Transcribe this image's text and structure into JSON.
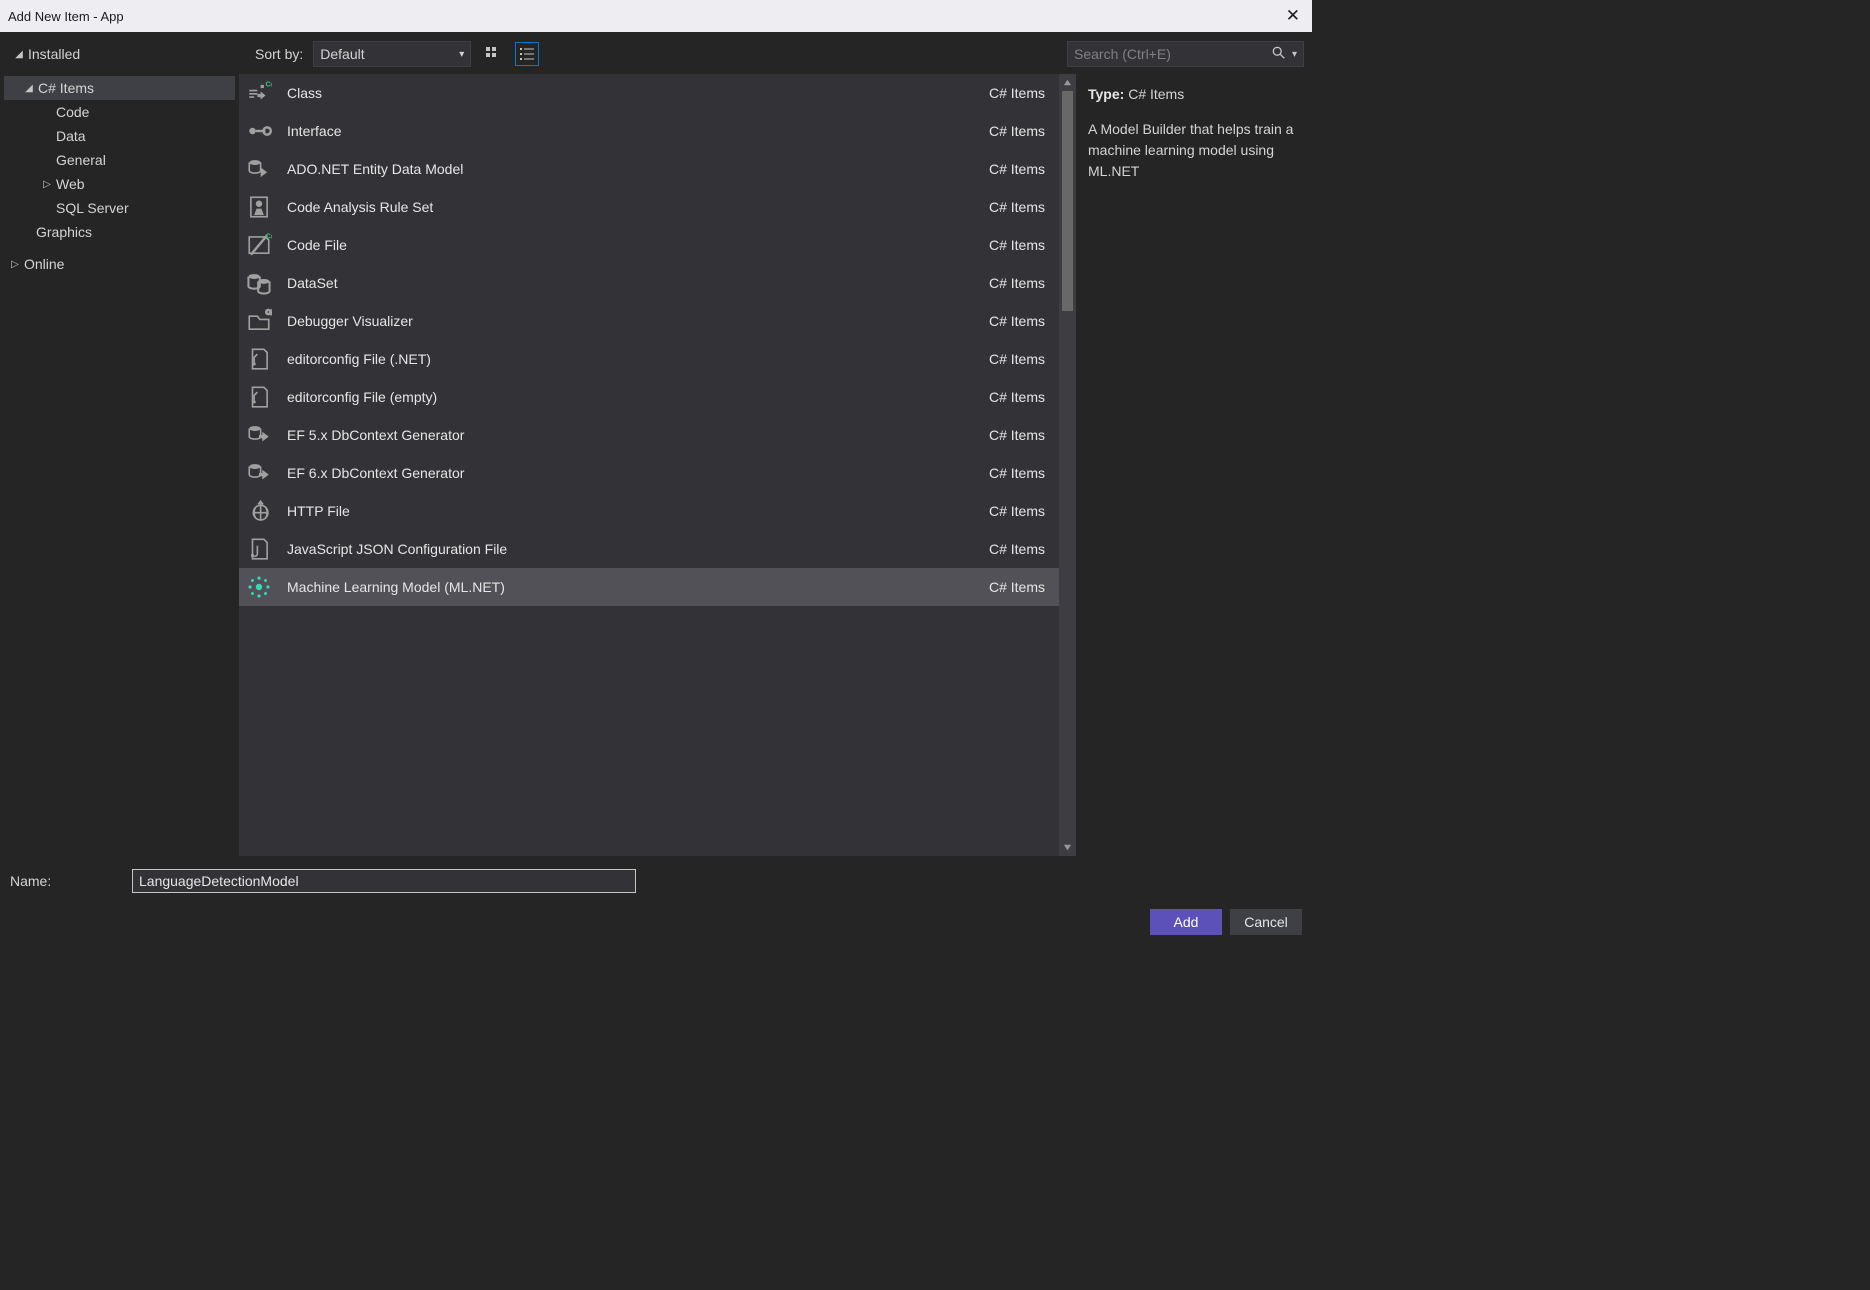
{
  "window": {
    "title": "Add New Item - App"
  },
  "sort": {
    "label": "Sort by:",
    "value": "Default"
  },
  "search": {
    "placeholder": "Search (Ctrl+E)"
  },
  "tree": {
    "installed": "Installed",
    "csitems": "C# Items",
    "nodes": {
      "code": "Code",
      "data": "Data",
      "general": "General",
      "web": "Web",
      "sqlserver": "SQL Server"
    },
    "graphics": "Graphics",
    "online": "Online"
  },
  "templates": [
    {
      "name": "Class",
      "cat": "C# Items",
      "icon": "class"
    },
    {
      "name": "Interface",
      "cat": "C# Items",
      "icon": "interface"
    },
    {
      "name": "ADO.NET Entity Data Model",
      "cat": "C# Items",
      "icon": "entity"
    },
    {
      "name": "Code Analysis Rule Set",
      "cat": "C# Items",
      "icon": "ruleset"
    },
    {
      "name": "Code File",
      "cat": "C# Items",
      "icon": "codefile"
    },
    {
      "name": "DataSet",
      "cat": "C# Items",
      "icon": "dataset"
    },
    {
      "name": "Debugger Visualizer",
      "cat": "C# Items",
      "icon": "folder"
    },
    {
      "name": "editorconfig File (.NET)",
      "cat": "C# Items",
      "icon": "config"
    },
    {
      "name": "editorconfig File (empty)",
      "cat": "C# Items",
      "icon": "config"
    },
    {
      "name": "EF 5.x DbContext Generator",
      "cat": "C# Items",
      "icon": "ef"
    },
    {
      "name": "EF 6.x DbContext Generator",
      "cat": "C# Items",
      "icon": "ef"
    },
    {
      "name": "HTTP File",
      "cat": "C# Items",
      "icon": "http"
    },
    {
      "name": "JavaScript JSON Configuration File",
      "cat": "C# Items",
      "icon": "js"
    },
    {
      "name": "Machine Learning Model (ML.NET)",
      "cat": "C# Items",
      "icon": "ml",
      "selected": true
    }
  ],
  "details": {
    "type_label": "Type:",
    "type_value": "C# Items",
    "description": "A Model Builder that helps train a machine learning model using ML.NET"
  },
  "name_field": {
    "label": "Name:",
    "value": "LanguageDetectionModel"
  },
  "buttons": {
    "add": "Add",
    "cancel": "Cancel"
  }
}
